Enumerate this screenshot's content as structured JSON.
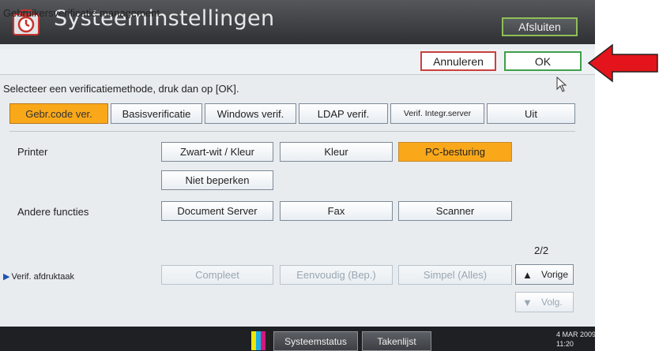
{
  "window": {
    "title": "Systeeminstellingen",
    "exit_label": "Afsluiten"
  },
  "header": {
    "title": "Gebruikersverificatie management",
    "cancel_label": "Annuleren",
    "ok_label": "OK"
  },
  "instruction": "Selecteer een verificatiemethode, druk dan op [OK].",
  "methods": [
    {
      "label": "Gebr.code ver.",
      "selected": true
    },
    {
      "label": "Basisverificatie",
      "selected": false
    },
    {
      "label": "Windows verif.",
      "selected": false
    },
    {
      "label": "LDAP verif.",
      "selected": false
    },
    {
      "label": "Verif. Integr.server",
      "selected": false
    },
    {
      "label": "Uit",
      "selected": false
    }
  ],
  "printer": {
    "label": "Printer",
    "options": [
      "Zwart-wit / Kleur",
      "Kleur",
      "PC-besturing",
      "Niet beperken"
    ],
    "selected": "PC-besturing"
  },
  "other_functions": {
    "label": "Andere functies",
    "options": [
      "Document Server",
      "Fax",
      "Scanner"
    ]
  },
  "print_job": {
    "label": "Verif. afdruktaak",
    "options": [
      "Compleet",
      "Eenvoudig (Bep.)",
      "Simpel (Alles)"
    ]
  },
  "pagination": {
    "indicator": "2/2",
    "prev_label": "Vorige",
    "next_label": "Volg."
  },
  "statusbar": {
    "cmyk_letters": "Y C M K",
    "system_status_label": "Systeemstatus",
    "job_list_label": "Takenlijst",
    "date": "4 MAR  2009",
    "time": "11:20"
  },
  "colors": {
    "selected": "#f9a81a",
    "ok_border": "#3fa04a",
    "cancel_border": "#c9403e",
    "arrow": "#e3141b"
  }
}
